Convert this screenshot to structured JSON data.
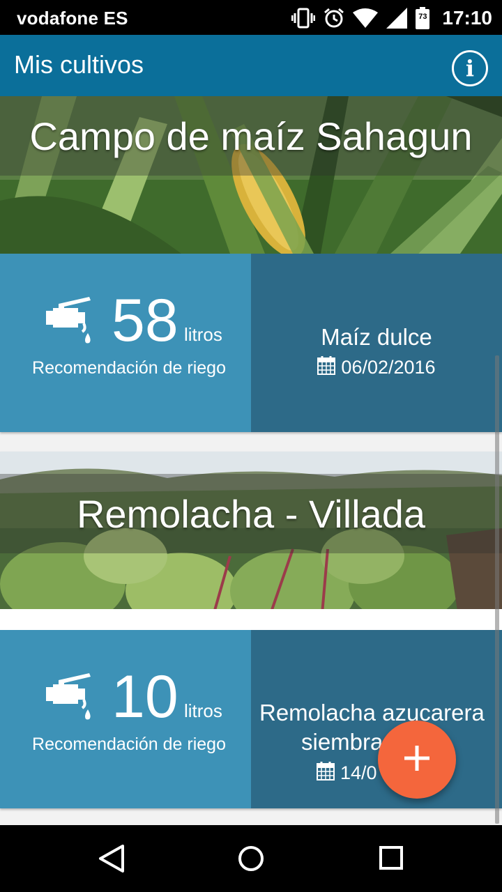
{
  "status_bar": {
    "carrier": "vodafone ES",
    "battery_level": "73",
    "time": "17:10",
    "icons": [
      "vibrate-icon",
      "alarm-icon",
      "wifi-icon",
      "signal-icon",
      "battery-icon"
    ]
  },
  "app_bar": {
    "title": "Mis cultivos",
    "info_icon": "i"
  },
  "cards": [
    {
      "title": "Campo de maíz Sahagun",
      "liters": "58",
      "unit": "litros",
      "recommendation_label": "Recomendación de riego",
      "crop_name": "Maíz dulce",
      "crop_name_line2": "",
      "date": "06/02/2016"
    },
    {
      "title": "Remolacha - Villada",
      "liters": "10",
      "unit": "litros",
      "recommendation_label": "Recomendación de riego",
      "crop_name": "Remolacha azucarera",
      "crop_name_line2": "siembra",
      "date": "14/0"
    }
  ],
  "fab": {
    "icon": "plus-icon"
  },
  "nav_bar": {
    "buttons": [
      "back-icon",
      "home-icon",
      "recents-icon"
    ]
  },
  "colors": {
    "app_bar": "#0b6f9a",
    "water_panel": "#3d92b7",
    "crop_panel": "#2d6a88",
    "fab": "#f4663c"
  }
}
